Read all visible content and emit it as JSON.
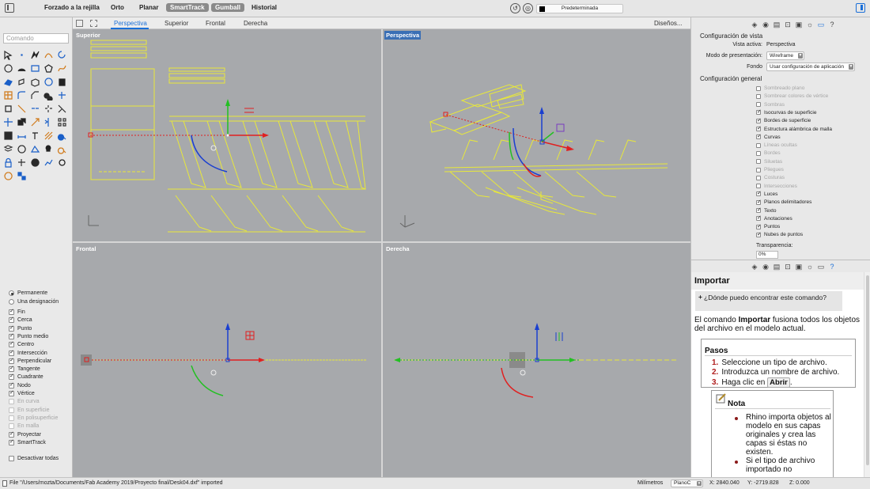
{
  "topbar": {
    "toggles": [
      {
        "label": "Forzado a la rejilla",
        "on": false
      },
      {
        "label": "Orto",
        "on": false
      },
      {
        "label": "Planar",
        "on": false
      },
      {
        "label": "SmartTrack",
        "on": true
      },
      {
        "label": "Gumball",
        "on": true
      },
      {
        "label": "Historial",
        "on": false
      }
    ],
    "layer": {
      "name": "Predeterminada",
      "color": "#000000"
    }
  },
  "viewport_tabs": [
    "Perspectiva",
    "Superior",
    "Frontal",
    "Derecha"
  ],
  "active_tab": "Perspectiva",
  "designs_label": "Diseños...",
  "command": {
    "placeholder": "Comando"
  },
  "tools": [
    "select-arrow-icon",
    "point-icon",
    "polyline-icon",
    "curve-icon",
    "rotate-view-icon",
    "circle-icon",
    "arc-icon",
    "rectangle-icon",
    "polygon-icon",
    "freeform-icon",
    "surface-icon",
    "extrude-icon",
    "box-icon",
    "sphere-icon",
    "cylinder-icon",
    "mesh-icon",
    "fillet-icon",
    "chamfer-icon",
    "boolean-icon",
    "cut-icon",
    "solid-tools-icon",
    "split-icon",
    "join-icon",
    "explode-icon",
    "trim-icon",
    "move-icon",
    "copy-icon",
    "scale-icon",
    "mirror-icon",
    "array-icon",
    "grid-icon",
    "dimension-icon",
    "text-icon",
    "hatch-icon",
    "zoom-icon",
    "layer-icon",
    "material-icon",
    "render-icon",
    "light-icon",
    "zoom-extents-icon",
    "lock-icon",
    "snap-icon",
    "color-wheel-icon",
    "analysis-icon",
    "settings-icon",
    "globe-icon",
    "group-icon"
  ],
  "osnap": {
    "modes": [
      {
        "label": "Permanente",
        "selected": true
      },
      {
        "label": "Una designación",
        "selected": false
      }
    ],
    "items": [
      {
        "label": "Fin",
        "checked": true,
        "enabled": true
      },
      {
        "label": "Cerca",
        "checked": true,
        "enabled": true
      },
      {
        "label": "Punto",
        "checked": true,
        "enabled": true
      },
      {
        "label": "Punto medio",
        "checked": true,
        "enabled": true
      },
      {
        "label": "Centro",
        "checked": true,
        "enabled": true
      },
      {
        "label": "Intersección",
        "checked": true,
        "enabled": true
      },
      {
        "label": "Perpendicular",
        "checked": true,
        "enabled": true
      },
      {
        "label": "Tangente",
        "checked": true,
        "enabled": true
      },
      {
        "label": "Cuadrante",
        "checked": true,
        "enabled": true
      },
      {
        "label": "Nodo",
        "checked": true,
        "enabled": true
      },
      {
        "label": "Vértice",
        "checked": true,
        "enabled": true
      },
      {
        "label": "En curva",
        "checked": false,
        "enabled": false
      },
      {
        "label": "En superficie",
        "checked": false,
        "enabled": false
      },
      {
        "label": "En polisuperficie",
        "checked": false,
        "enabled": false
      },
      {
        "label": "En malla",
        "checked": false,
        "enabled": false
      },
      {
        "label": "Proyectar",
        "checked": true,
        "enabled": true
      },
      {
        "label": "SmartTrack",
        "checked": true,
        "enabled": true
      }
    ],
    "disable_all": "Desactivar todas"
  },
  "viewports": [
    {
      "name": "Superior",
      "active": false
    },
    {
      "name": "Perspectiva",
      "active": true
    },
    {
      "name": "Frontal",
      "active": false
    },
    {
      "name": "Derecha",
      "active": false
    }
  ],
  "view_settings": {
    "heading": "Configuración de vista",
    "active_view_label": "Vista activa:",
    "active_view_value": "Perspectiva",
    "display_mode_label": "Modo de presentación:",
    "display_mode_value": "Wireframe",
    "background_label": "Fondo",
    "background_value": "Usar configuración de aplicación",
    "general_heading": "Configuración general",
    "options": [
      {
        "label": "Sombreado plano",
        "checked": false,
        "enabled": false
      },
      {
        "label": "Sombrear colores de vértice",
        "checked": false,
        "enabled": false
      },
      {
        "label": "Sombras",
        "checked": false,
        "enabled": false
      },
      {
        "label": "Isocurvas de superficie",
        "checked": true,
        "enabled": true
      },
      {
        "label": "Bordes de superficie",
        "checked": true,
        "enabled": true
      },
      {
        "label": "Estructura alámbrica de malla",
        "checked": true,
        "enabled": true
      },
      {
        "label": "Curvas",
        "checked": true,
        "enabled": true
      },
      {
        "label": "Líneas ocultas",
        "checked": true,
        "enabled": false
      },
      {
        "label": "Bordes",
        "checked": true,
        "enabled": false
      },
      {
        "label": "Siluetas",
        "checked": true,
        "enabled": false
      },
      {
        "label": "Pliegues",
        "checked": true,
        "enabled": false
      },
      {
        "label": "Costuras",
        "checked": false,
        "enabled": false
      },
      {
        "label": "Intersecciones",
        "checked": true,
        "enabled": false
      },
      {
        "label": "Luces",
        "checked": true,
        "enabled": true
      },
      {
        "label": "Planos delimitadores",
        "checked": true,
        "enabled": true
      },
      {
        "label": "Texto",
        "checked": true,
        "enabled": true
      },
      {
        "label": "Anotaciones",
        "checked": true,
        "enabled": true
      },
      {
        "label": "Puntos",
        "checked": true,
        "enabled": true
      },
      {
        "label": "Nubes de puntos",
        "checked": true,
        "enabled": true
      }
    ],
    "transparency_label": "Transparencia:",
    "transparency_value": "0%"
  },
  "help": {
    "title": "Importar",
    "faq": "¿Dónde puedo encontrar este comando?",
    "intro_pre": "El comando ",
    "intro_bold": "Importar",
    "intro_post": " fusiona todos los objetos del archivo en el modelo actual.",
    "steps_title": "Pasos",
    "steps": [
      {
        "num": "1.",
        "text": "Seleccione un tipo de archivo."
      },
      {
        "num": "2.",
        "text": "Introduzca un nombre de archivo."
      },
      {
        "num": "3.",
        "text_pre": "Haga clic en ",
        "key": "Abrir",
        "text_post": "."
      }
    ],
    "note_title": "Nota",
    "note_items": [
      "Rhino importa objetos al modelo en sus capas originales y crea las capas si éstas no existen.",
      "Si el tipo de archivo importado no"
    ]
  },
  "status": {
    "message": "File \"/Users/mozta/Documents/Fab Academy 2019/Proyecto final/Desk04.dxf\" imported",
    "units": "Milímetros",
    "cplane": "PlanoC",
    "x": "X: 2840.040",
    "y": "Y: -2719.828",
    "z": "Z: 0.000"
  },
  "colors": {
    "accent": "#1a6fd8",
    "geometry": "#e8e83a",
    "viewport_bg": "#a7a9ac",
    "x_axis": "#e02020",
    "y_axis": "#22c022",
    "z_axis": "#1a3fd0"
  }
}
